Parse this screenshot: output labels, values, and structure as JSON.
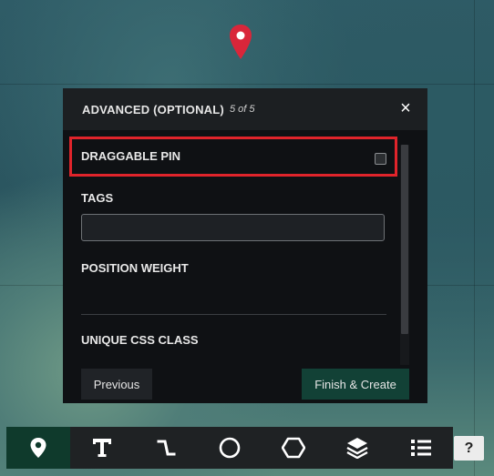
{
  "panel": {
    "title": "ADVANCED (OPTIONAL)",
    "step": "5 of 5",
    "close_label": "×",
    "fields": {
      "draggable_pin": "DRAGGABLE PIN",
      "tags": "TAGS",
      "position_weight": "POSITION WEIGHT",
      "unique_css_class": "UNIQUE CSS CLASS"
    },
    "tags_value": "",
    "draggable_checked": false,
    "previous_label": "Previous",
    "finish_label": "Finish & Create"
  },
  "toolbar": {
    "tools": [
      {
        "name": "marker",
        "icon": "map-pin-icon",
        "active": true
      },
      {
        "name": "text",
        "icon": "text-icon",
        "active": false
      },
      {
        "name": "polyline",
        "icon": "polyline-icon",
        "active": false
      },
      {
        "name": "circle",
        "icon": "circle-icon",
        "active": false
      },
      {
        "name": "polygon",
        "icon": "hexagon-icon",
        "active": false
      },
      {
        "name": "layers",
        "icon": "layers-icon",
        "active": false
      },
      {
        "name": "list",
        "icon": "list-icon",
        "active": false
      }
    ],
    "help_label": "?"
  },
  "colors": {
    "panel_bg": "#0f1114",
    "header_bg": "#1c1f22",
    "highlight": "#e0242b",
    "active_tool": "#0f3a2c",
    "finish_button": "#124136",
    "pin": "#d9263a"
  }
}
